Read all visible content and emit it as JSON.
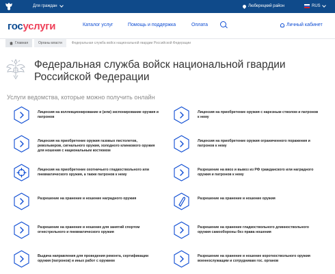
{
  "topbar": {
    "audience": "Для граждан",
    "region": "Люберецкий район",
    "language": "RUS"
  },
  "header": {
    "logo_part1": "гос",
    "logo_part2": "услуги",
    "nav": [
      "Каталог услуг",
      "Помощь и поддержка",
      "Оплата"
    ],
    "cabinet": "Личный кабинет"
  },
  "breadcrumb": {
    "home": "Главная",
    "section": "Органы власти",
    "current": "Федеральная служба войск национальной гвардии Российской Федерации"
  },
  "page": {
    "title": "Федеральная служба войск национальной гвардии Российской Федерации",
    "subtitle": "Услуги ведомства, которые можно получить онлайн"
  },
  "services": [
    {
      "label": "Лицензия на коллекционирование и (или) экспонирование оружия и патронов",
      "icon": "chevron-right-icon"
    },
    {
      "label": "Лицензия на приобретение оружия с нарезным стволом и патронов к нему",
      "icon": "chevron-right-icon"
    },
    {
      "label": "Лицензия на приобретение оружия газовых пистолетов, револьверов, сигнального оружия, холодного клинкового оружия для ношения с национальным костюмом",
      "icon": "chevron-right-icon"
    },
    {
      "label": "Лицензия на приобретение оружия ограниченного поражения и патронов к нему",
      "icon": "chevron-right-icon"
    },
    {
      "label": "Лицензия на приобретение охотничьего гладкоствольного или пневматического оружия, а также патронов к нему",
      "icon": "crosshair-icon"
    },
    {
      "label": "Разрешение на ввоз и вывоз из РФ гражданского или наградного оружия и патронов к нему",
      "icon": "chevron-right-icon"
    },
    {
      "label": "Разрешение на хранение и ношение наградного оружия",
      "icon": "chevron-right-icon"
    },
    {
      "label": "Разрешение на хранение и ношение оружия",
      "icon": "bullet-icon"
    },
    {
      "label": "Разрешение на хранение и ношение для занятий спортом огнестрельного и пневматического оружия",
      "icon": "chevron-right-icon"
    },
    {
      "label": "Разрешение на хранение гладкоствольного длинноствольного оружия самообороны без права ношения",
      "icon": "chevron-right-icon"
    },
    {
      "label": "Выдача направления для проведения ремонта, сертификации оружия (патронов) и иных работ с оружием",
      "icon": "chevron-right-icon"
    },
    {
      "label": "Разрешение на хранение и ношение короткоствольного оружия военнослужащим и сотрудникам гос. органов",
      "icon": "chevron-right-icon"
    }
  ],
  "colors": {
    "topbar": "#0f4a8a",
    "accent": "#0d4cd3",
    "logo_red": "#ee3f58"
  }
}
